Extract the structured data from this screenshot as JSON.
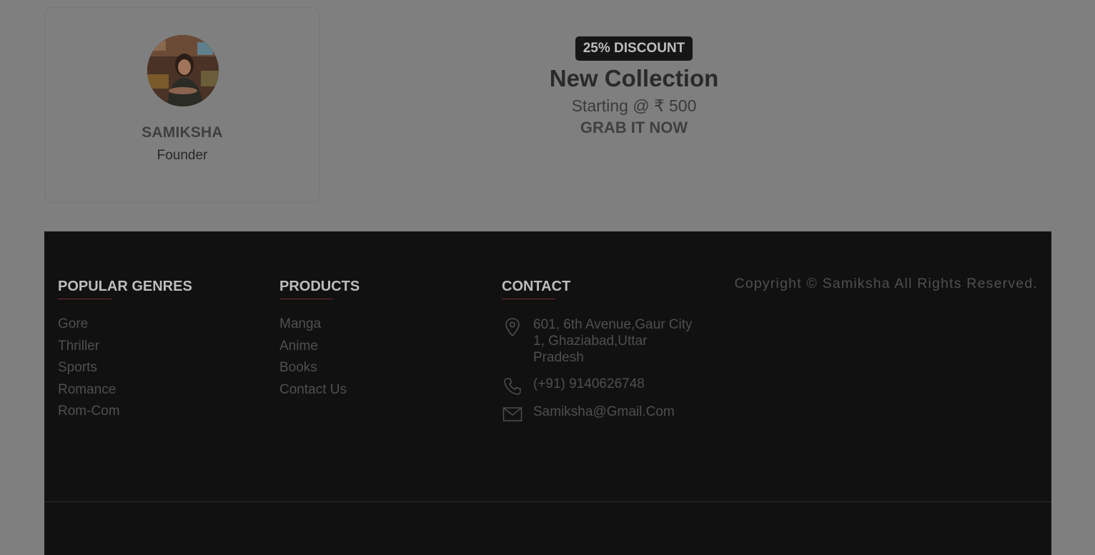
{
  "founder": {
    "name": "SAMIKSHA",
    "role": "Founder"
  },
  "promo": {
    "badge": "25% DISCOUNT",
    "title": "New Collection",
    "price": "Starting @ ₹ 500",
    "cta": "GRAB IT NOW"
  },
  "footer": {
    "genres": {
      "heading": "POPULAR GENRES",
      "items": [
        "Gore",
        "Thriller",
        "Sports",
        "Romance",
        "Rom-Com"
      ]
    },
    "products": {
      "heading": "PRODUCTS",
      "items": [
        "Manga",
        "Anime",
        "Books",
        "Contact Us"
      ]
    },
    "contact": {
      "heading": "CONTACT",
      "address": "601, 6th Avenue,Gaur City 1, Ghaziabad,Uttar Pradesh",
      "phone": "(+91) 9140626748",
      "email": "Samiksha@Gmail.Com"
    },
    "copyright": "Copyright © Samiksha All Rights Reserved."
  },
  "colors": {
    "overlay_bg": "#7f7f7f",
    "footer_bg": "#111111",
    "accent_underline": "#7a2b2b"
  },
  "icons": {
    "address": "location-pin-icon",
    "phone": "phone-icon",
    "email": "envelope-icon"
  }
}
